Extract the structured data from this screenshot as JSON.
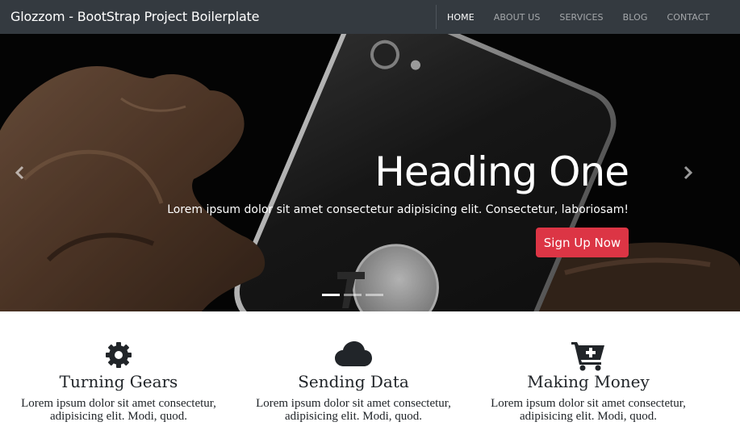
{
  "navbar": {
    "brand": "Glozzom - BootStrap Project Boilerplate",
    "items": [
      {
        "label": "HOME",
        "active": true
      },
      {
        "label": "ABOUT US",
        "active": false
      },
      {
        "label": "SERVICES",
        "active": false
      },
      {
        "label": "BLOG",
        "active": false
      },
      {
        "label": "CONTACT",
        "active": false
      }
    ]
  },
  "carousel": {
    "heading": "Heading One",
    "text": "Lorem ipsum dolor sit amet consectetur adipisicing elit. Consectetur, laboriosam!",
    "button_label": "Sign Up Now",
    "button_color": "#dc3545",
    "prev_icon": "chevron-left-icon",
    "next_icon": "chevron-right-icon",
    "slide_count": 3,
    "active_slide": 1
  },
  "features": [
    {
      "icon": "gear-icon",
      "title": "Turning Gears",
      "text": "Lorem ipsum dolor sit amet consectetur, adipisicing elit. Modi, quod."
    },
    {
      "icon": "cloud-icon",
      "title": "Sending Data",
      "text": "Lorem ipsum dolor sit amet consectetur, adipisicing elit. Modi, quod."
    },
    {
      "icon": "cart-plus-icon",
      "title": "Making Money",
      "text": "Lorem ipsum dolor sit amet consectetur, adipisicing elit. Modi, quod."
    }
  ],
  "colors": {
    "navbar_bg": "#343a40",
    "icon_color": "#212529"
  }
}
